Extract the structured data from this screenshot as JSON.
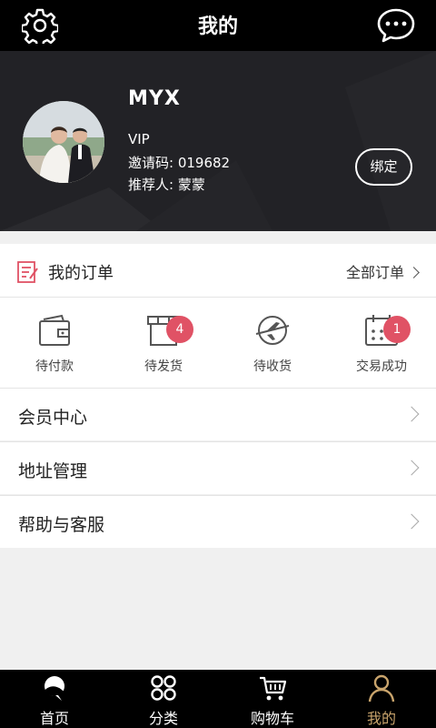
{
  "header": {
    "title": "我的"
  },
  "profile": {
    "name": "MYX",
    "level": "VIP",
    "invite_code": "邀请码: 019682",
    "referrer": "推荐人: 蒙蒙",
    "bind_label": "绑定"
  },
  "orders": {
    "title": "我的订单",
    "all_label": "全部订单",
    "statuses": [
      {
        "label": "待付款",
        "icon": "wallet-icon"
      },
      {
        "label": "待发货",
        "icon": "gift-box-icon",
        "badge": "4"
      },
      {
        "label": "待收货",
        "icon": "airplane-icon"
      },
      {
        "label": "交易成功",
        "icon": "calendar-icon",
        "badge": "1"
      }
    ]
  },
  "menu": [
    {
      "label": "会员中心"
    },
    {
      "label": "地址管理"
    },
    {
      "label": "帮助与客服"
    }
  ],
  "tabs": [
    {
      "label": "首页",
      "icon": "home-logo-icon"
    },
    {
      "label": "分类",
      "icon": "category-grid-icon"
    },
    {
      "label": "购物车",
      "icon": "cart-icon"
    },
    {
      "label": "我的",
      "icon": "user-icon",
      "active": true
    }
  ],
  "colors": {
    "badge": "#e05265",
    "active_tab": "#c9a46c",
    "order_icon": "#e05265"
  }
}
